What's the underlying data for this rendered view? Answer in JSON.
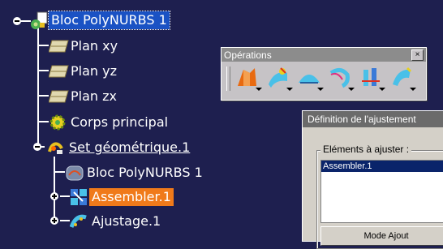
{
  "tree": {
    "root": {
      "label": "Bloc PolyNURBS 1",
      "icon": "polynurbs-part-icon"
    },
    "planes": [
      {
        "label": "Plan xy",
        "icon": "plane-icon"
      },
      {
        "label": "Plan yz",
        "icon": "plane-icon"
      },
      {
        "label": "Plan zx",
        "icon": "plane-icon"
      }
    ],
    "body": {
      "label": "Corps principal",
      "icon": "body-gear-icon"
    },
    "geoset": {
      "label": "Set géométrique.1",
      "icon": "geometrical-set-icon"
    },
    "geo_children": [
      {
        "label": "Bloc PolyNURBS 1",
        "icon": "polynurbs-block-icon"
      },
      {
        "label": "Assembler.1",
        "icon": "assemble-icon",
        "state": "highlighted"
      },
      {
        "label": "Ajustage.1",
        "icon": "fitting-icon"
      }
    ],
    "colors": {
      "background": "#1e1f4f",
      "selection": "#1a52c4",
      "highlight": "#f07a1a"
    }
  },
  "operations_toolbar": {
    "title": "Opérations",
    "close_label": "×",
    "tools": [
      "extrude-tool-icon",
      "surface-tool-icon",
      "blend-tool-icon",
      "sweep-tool-icon",
      "fill-tool-icon",
      "fit-tool-icon"
    ]
  },
  "adjust_dialog": {
    "title": "Définition de l'ajustement",
    "group_label": "Eléments à ajuster :",
    "list_items": [
      "Assembler.1"
    ],
    "mode_button_label": "Mode Ajout"
  }
}
